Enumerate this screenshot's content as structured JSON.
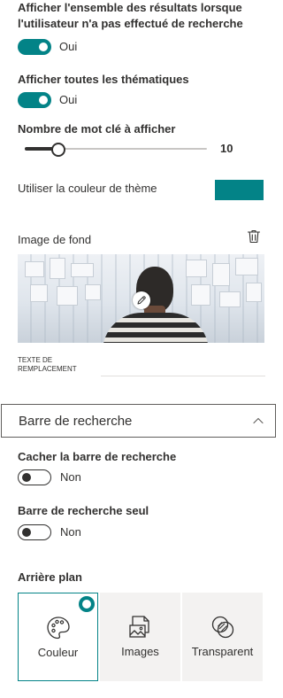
{
  "settings": {
    "show_all_results": {
      "label": "Afficher l'ensemble des résultats lorsque l'utilisateur n'a pas effectué de recherche",
      "state": "Oui",
      "on": true
    },
    "show_all_topics": {
      "label": "Afficher toutes les thématiques",
      "state": "Oui",
      "on": true
    },
    "keyword_count": {
      "label": "Nombre de mot clé à afficher",
      "value": "10",
      "fraction": 0.18
    },
    "theme_color": {
      "label": "Utiliser la couleur de thème",
      "color": "#038387"
    },
    "background_image": {
      "label": "Image de fond",
      "delete_icon": "trash-icon",
      "edit_icon": "pencil-icon",
      "alt_text_label": "TEXTE DE REMPLACEMENT",
      "alt_text_value": ""
    }
  },
  "search_bar_section": {
    "title": "Barre de recherche",
    "expanded": true,
    "hide_search_bar": {
      "label": "Cacher la barre de recherche",
      "state": "Non",
      "on": false
    },
    "search_bar_only": {
      "label": "Barre de recherche seul",
      "state": "Non",
      "on": false
    },
    "background": {
      "label": "Arrière plan",
      "options": [
        {
          "label": "Couleur",
          "icon": "palette-icon",
          "selected": true
        },
        {
          "label": "Images",
          "icon": "image-icon",
          "selected": false
        },
        {
          "label": "Transparent",
          "icon": "transparent-icon",
          "selected": false
        }
      ]
    }
  },
  "colors": {
    "accent": "#038387",
    "text": "#323130",
    "tile_background": "#f3f2f1"
  }
}
